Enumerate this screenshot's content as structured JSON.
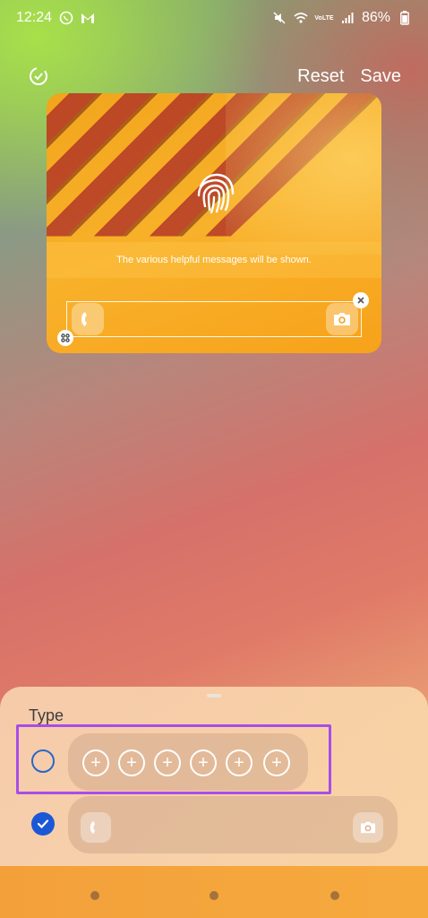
{
  "status": {
    "time": "12:24",
    "battery": "86%",
    "icons": [
      "whatsapp-icon",
      "gmail-icon",
      "mute-icon",
      "wifi-icon",
      "volte-icon",
      "signal-icon",
      "battery-icon"
    ]
  },
  "top_bar": {
    "reset_label": "Reset",
    "save_label": "Save",
    "left_icon": "rotate-icon"
  },
  "preview": {
    "message": "The various helpful messages will be shown.",
    "left_shortcut": "phone-icon",
    "right_shortcut": "camera-icon"
  },
  "sheet": {
    "title": "Type",
    "options": [
      {
        "selected": false,
        "plus_buttons": [
          "+",
          "+",
          "+",
          "+",
          "+",
          "+"
        ]
      },
      {
        "selected": true,
        "left_icon": "phone-icon",
        "right_icon": "camera-icon"
      }
    ]
  },
  "colors": {
    "accent_blue": "#1c57d6",
    "highlight_purple": "#a64ee8"
  }
}
